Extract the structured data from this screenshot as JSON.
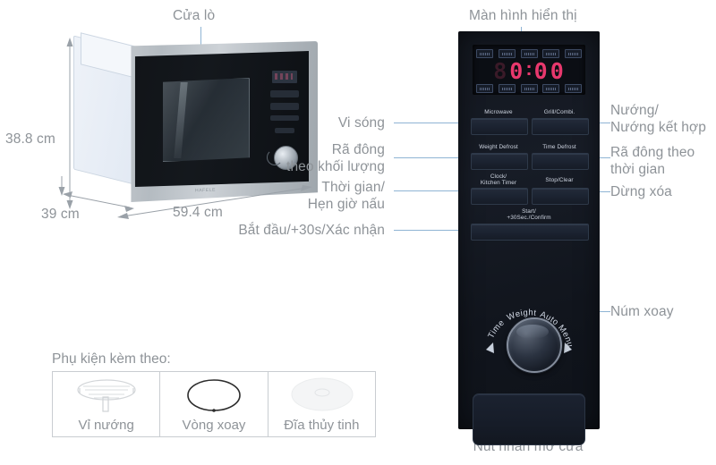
{
  "callouts": {
    "door": "Cửa lò",
    "display": "Màn hình hiển thị",
    "microwave": "Vi sóng",
    "weight_defrost": "Rã đông\ntheo khối lượng",
    "weight_defrost_l1": "Rã đông",
    "weight_defrost_l2": "theo khối lượng",
    "clock_timer_l1": "Thời gian/",
    "clock_timer_l2": "Hẹn giờ nấu",
    "start": "Bắt đầu/+30s/Xác nhận",
    "grill_l1": "Nướng/",
    "grill_l2": "Nướng kết hợp",
    "time_defrost_l1": "Rã đông theo",
    "time_defrost_l2": "thời gian",
    "stop_clear": "Dừng xóa",
    "knob": "Núm xoay",
    "door_button": "Nút nhấn mở cửa"
  },
  "dimensions": {
    "height": "38.8 cm",
    "depth": "39 cm",
    "width": "59.4 cm"
  },
  "accessories": {
    "title": "Phụ kiện kèm theo:",
    "items": [
      {
        "label": "Vỉ nướng",
        "icon": "grill-rack-icon"
      },
      {
        "label": "Vòng xoay",
        "icon": "roller-ring-icon"
      },
      {
        "label": "Đĩa thủy tinh",
        "icon": "glass-plate-icon"
      }
    ]
  },
  "panel": {
    "display": {
      "digits": [
        "8",
        "0",
        "0",
        "0"
      ],
      "colon": ":",
      "leading_dim": true,
      "top_indicators": [
        "indicator-1",
        "indicator-2",
        "indicator-3",
        "indicator-4",
        "indicator-5"
      ],
      "bottom_indicators": [
        "indicator-6",
        "indicator-7",
        "indicator-8",
        "indicator-9",
        "indicator-10"
      ]
    },
    "buttons": [
      {
        "label": "Microwave",
        "name": "microwave-button"
      },
      {
        "label": "Grill/Combi.",
        "name": "grill-combi-button"
      },
      {
        "label": "Weight Defrost",
        "name": "weight-defrost-button"
      },
      {
        "label": "Time Defrost",
        "name": "time-defrost-button"
      },
      {
        "label": "Clock/\nKitchen Timer",
        "name": "clock-kitchen-timer-button"
      },
      {
        "label": "Stop/Clear",
        "name": "stop-clear-button"
      },
      {
        "label": "Start/\n+30Sec./Confirm",
        "name": "start-confirm-button"
      }
    ],
    "button_labels": {
      "microwave": "Microwave",
      "grill": "Grill/Combi.",
      "weight_defrost": "Weight Defrost",
      "time_defrost": "Time Defrost",
      "clock_l1": "Clock/",
      "clock_l2": "Kitchen Timer",
      "stop": "Stop/Clear",
      "start_l1": "Start/",
      "start_l2": "+30Sec./Confirm"
    },
    "knob_arc": {
      "time": "Time",
      "weight": "Weight",
      "auto_menu": "Auto Menu"
    }
  },
  "colors": {
    "label_text": "#8e9398",
    "leader_line": "#8fb4d4",
    "panel_bg": "#13171f",
    "display_digit": "#e8386d",
    "button_face": "#1f2736",
    "steel": "#b4bbc1"
  }
}
